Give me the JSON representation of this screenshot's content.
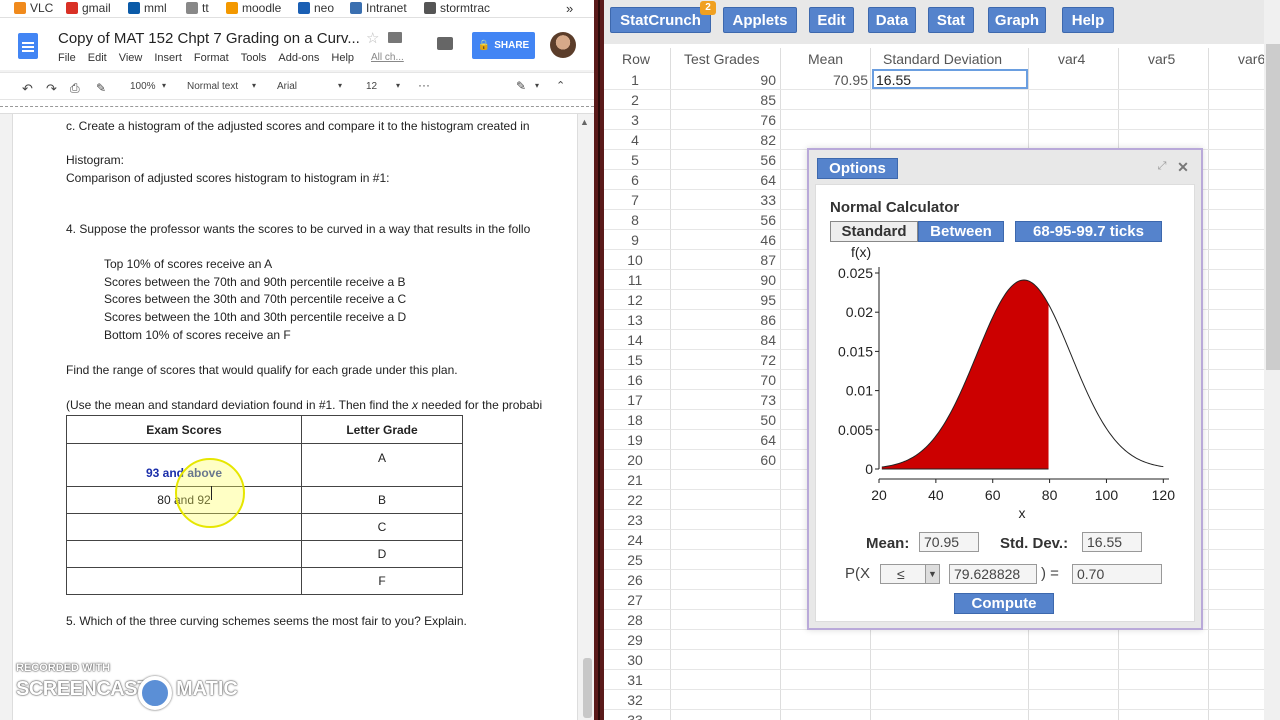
{
  "bookmarks": [
    {
      "label": "VLC",
      "icon": "vlc-icon",
      "color": "#f08a1c"
    },
    {
      "label": "gmail",
      "icon": "gmail-icon",
      "color": "#d93025"
    },
    {
      "label": "mml",
      "icon": "pearson-icon",
      "color": "#0a5aa8"
    },
    {
      "label": "tt",
      "icon": "tt-icon",
      "color": "#888888"
    },
    {
      "label": "moodle",
      "icon": "moodle-icon",
      "color": "#f39800"
    },
    {
      "label": "neo",
      "icon": "neo-icon",
      "color": "#1a5fb4"
    },
    {
      "label": "Intranet",
      "icon": "intranet-icon",
      "color": "#3a6fb0"
    },
    {
      "label": "stormtrac",
      "icon": "stormtrac-icon",
      "color": "#555555"
    }
  ],
  "docs": {
    "title": "Copy of MAT 152 Chpt 7 Grading on a Curv...",
    "menus": [
      "File",
      "Edit",
      "View",
      "Insert",
      "Format",
      "Tools",
      "Add-ons",
      "Help"
    ],
    "all_changes": "All ch...",
    "share": "SHARE",
    "toolbar": {
      "zoom": "100%",
      "style": "Normal text",
      "font": "Arial",
      "size": "12",
      "more": "···"
    },
    "lines": {
      "c": "c. Create a histogram of the adjusted scores and compare it to the histogram created in",
      "histogram": "Histogram:",
      "comparison": "Comparison of adjusted scores histogram to histogram in #1:",
      "q4": "4. Suppose the professor wants the scores to be curved in a way that results in the follo",
      "b1": "Top 10% of scores receive an A",
      "b2": "Scores between the 70th and 90th percentile receive a B",
      "b3": "Scores between the 30th and 70th percentile receive a C",
      "b4": "Scores between the 10th and 30th percentile receive a D",
      "b5": "Bottom 10% of scores receive an F",
      "find": "Find the range of scores that would qualify for each grade under this plan.",
      "use_pre": "(Use the mean and standard deviation found in #1. Then find the ",
      "use_x": "x",
      "use_post": " needed for the probabi",
      "q5": "5. Which of the three curving schemes seems the most fair to you? Explain."
    },
    "table": {
      "headers": [
        "Exam Scores",
        "Letter Grade"
      ],
      "rows": [
        {
          "score": "93 and above",
          "grade": "A"
        },
        {
          "score": "80 and 92",
          "grade": "B"
        },
        {
          "score": "",
          "grade": "C"
        },
        {
          "score": "",
          "grade": "D"
        },
        {
          "score": "",
          "grade": "F"
        }
      ]
    },
    "watermark": {
      "line1": "RECORDED WITH",
      "line2": "SCREENCAST",
      "line3": "MATIC"
    }
  },
  "statcrunch": {
    "menu": [
      "StatCrunch",
      "Applets",
      "Edit",
      "Data",
      "Stat",
      "Graph",
      "Help"
    ],
    "badge": "2",
    "columns": [
      "Row",
      "Test Grades",
      "Mean",
      "Standard Deviation",
      "var4",
      "var5",
      "var6"
    ],
    "rows": [
      "1",
      "2",
      "3",
      "4",
      "5",
      "6",
      "7",
      "8",
      "9",
      "10",
      "11",
      "12",
      "13",
      "14",
      "15",
      "16",
      "17",
      "18",
      "19",
      "20",
      "21",
      "22",
      "23",
      "24",
      "25",
      "26",
      "27",
      "28",
      "29",
      "30",
      "31",
      "32",
      "33"
    ],
    "test_grades": [
      "90",
      "85",
      "76",
      "82",
      "56",
      "64",
      "33",
      "56",
      "46",
      "87",
      "90",
      "95",
      "86",
      "84",
      "72",
      "70",
      "73",
      "50",
      "64",
      "60"
    ],
    "mean": "70.95",
    "std": "16.55",
    "dialog": {
      "options": "Options",
      "title": "Normal Calculator",
      "modes": [
        "Standard",
        "Between",
        "68-95-99.7 ticks"
      ],
      "mean_label": "Mean:",
      "mean_value": "70.95",
      "sd_label": "Std. Dev.:",
      "sd_value": "16.55",
      "p_prefix": "P(",
      "p_var": "X",
      "operator": "≤",
      "x_value": "79.628828",
      "p_suffix": ") =",
      "p_result": "0.70",
      "compute": "Compute"
    }
  },
  "chart_data": {
    "type": "area",
    "title": "",
    "xlabel": "x",
    "ylabel": "f(x)",
    "xlim": [
      20,
      122
    ],
    "ylim": [
      0,
      0.025
    ],
    "xticks": [
      "20",
      "40",
      "60",
      "80",
      "100",
      "120"
    ],
    "yticks": [
      "0",
      "0.005",
      "0.01",
      "0.015",
      "0.02",
      "0.025"
    ],
    "distribution": {
      "mean": 70.95,
      "sd": 16.55
    },
    "shaded": {
      "from": 20,
      "to": 79.628828,
      "color": "#cc0000"
    }
  }
}
